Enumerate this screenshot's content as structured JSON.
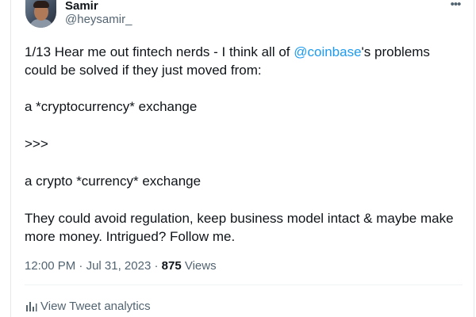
{
  "author": {
    "name": "Samir",
    "handle": "@heysamir_"
  },
  "menu": {
    "icon": "more-horizontal-icon",
    "label": "•••"
  },
  "tweet": {
    "line1_before": "1/13 Hear me out fintech nerds - I think all of ",
    "line1_mention": "@coinbase",
    "line1_after": "'s problems",
    "line2": "could be solved if they just moved from:",
    "line3": "a *cryptocurrency* exchange",
    "line4": ">>>",
    "line5": "a crypto *currency* exchange",
    "line6": "They could avoid regulation, keep business model intact & maybe make",
    "line7": "more money. Intrigued? Follow me."
  },
  "meta": {
    "time": "12:00 PM",
    "date": "Jul 31, 2023",
    "separator": " · ",
    "views_count": "875",
    "views_label": "Views"
  },
  "analytics": {
    "label": "View Tweet analytics",
    "icon": "bar-chart-icon"
  },
  "colors": {
    "link": "#1d9bf0",
    "secondary_text": "#536471",
    "primary_text": "#0f1419"
  }
}
